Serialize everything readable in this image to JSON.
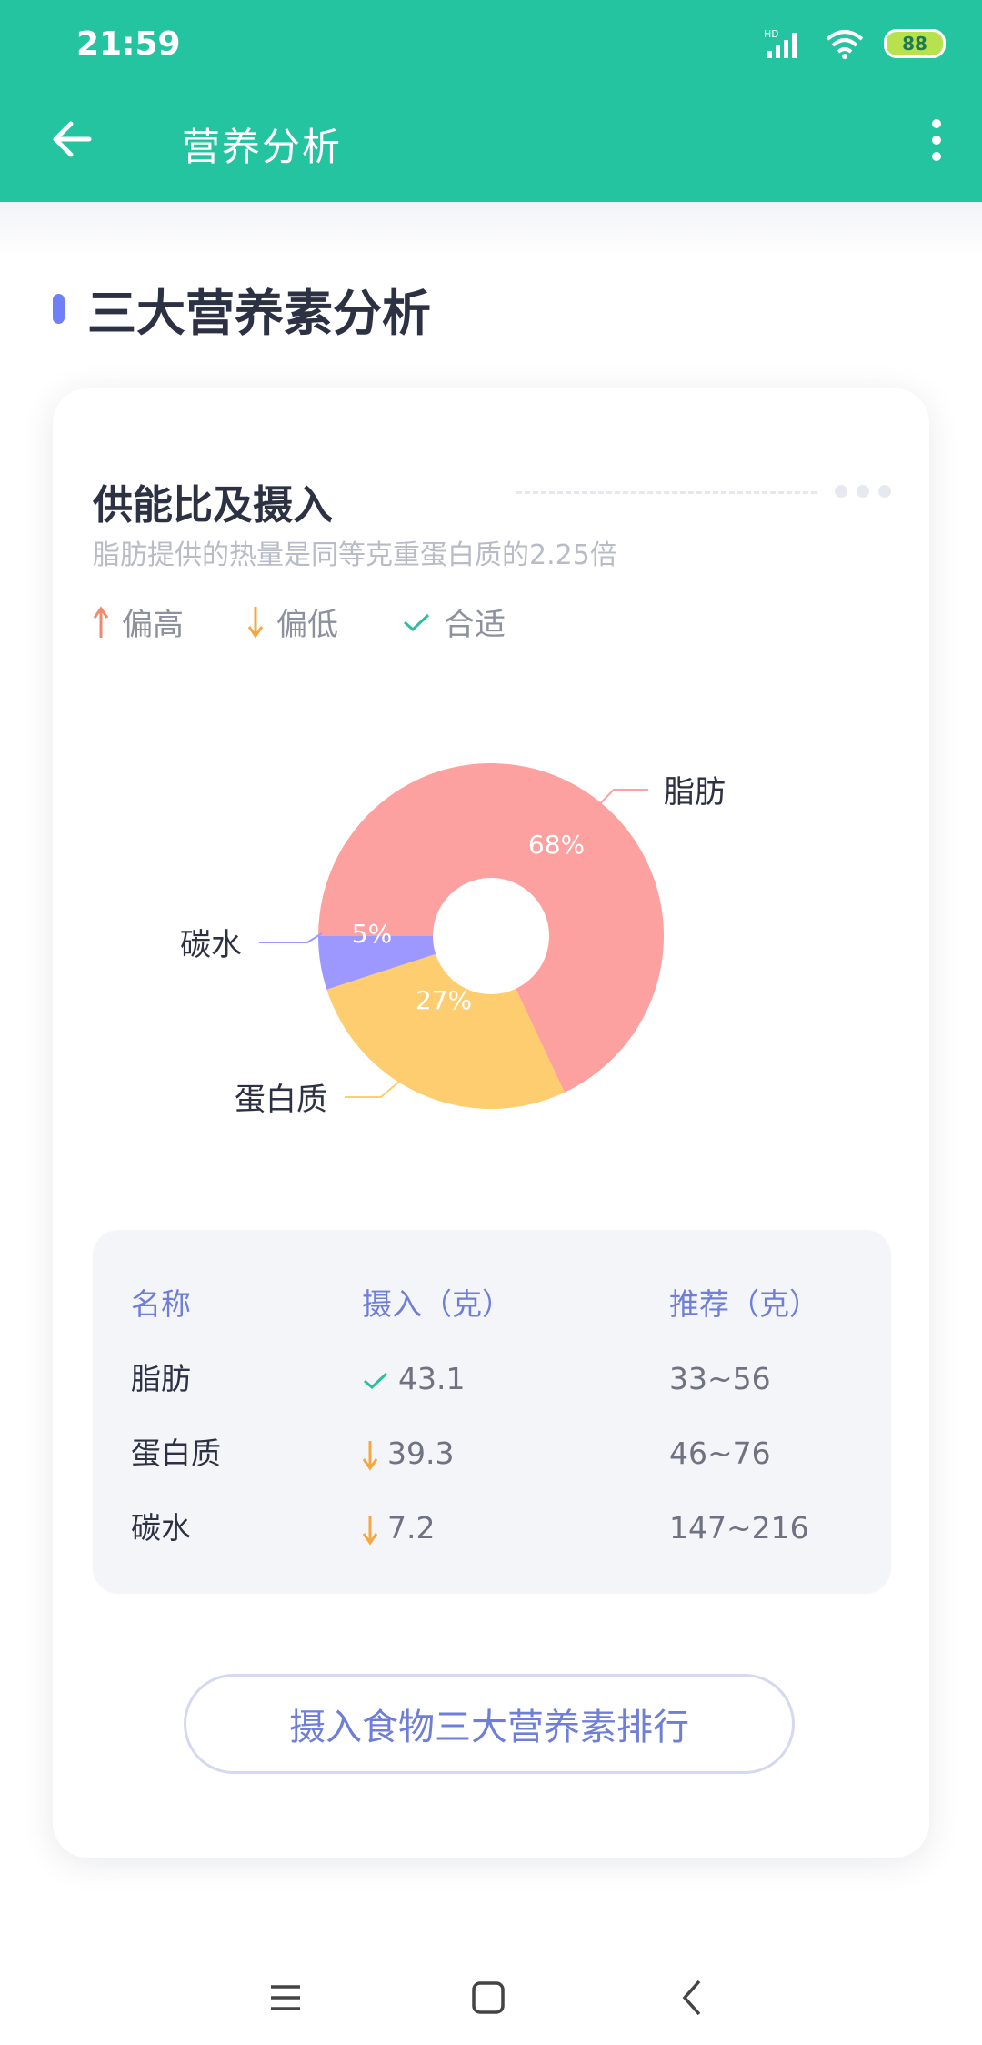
{
  "status_bar": {
    "time": "21:59",
    "network": "HD",
    "battery": "88"
  },
  "app_bar": {
    "title": "营养分析",
    "back_icon": "back-arrow-icon",
    "menu_icon": "more-vertical-icon"
  },
  "section": {
    "title": "三大营养素分析"
  },
  "card": {
    "title": "供能比及摄入",
    "subtitle": "脂肪提供的热量是同等克重蛋白质的2.25倍",
    "legend": [
      {
        "label": "偏高",
        "icon": "arrow-up-icon",
        "color": "#f08a6c"
      },
      {
        "label": "偏低",
        "icon": "arrow-down-icon",
        "color": "#f5a742"
      },
      {
        "label": "合适",
        "icon": "check-icon",
        "color": "#2cbf9f"
      }
    ]
  },
  "chart_data": {
    "type": "pie",
    "categories": [
      "脂肪",
      "蛋白质",
      "碳水"
    ],
    "values": [
      68,
      27,
      5
    ],
    "data_labels": [
      "68%",
      "27%",
      "5%"
    ],
    "colors": [
      "#fca19f",
      "#fdcd70",
      "#9c98ff"
    ],
    "donut": true
  },
  "table": {
    "headers": [
      "名称",
      "摄入（克）",
      "推荐（克）"
    ],
    "rows": [
      {
        "name": "脂肪",
        "status": "check-icon",
        "intake": "43.1",
        "recommended": "33~56"
      },
      {
        "name": "蛋白质",
        "status": "arrow-down-icon",
        "intake": "39.3",
        "recommended": "46~76"
      },
      {
        "name": "碳水",
        "status": "arrow-down-icon",
        "intake": "7.2",
        "recommended": "147~216"
      }
    ]
  },
  "button": {
    "label": "摄入食物三大营养素排行"
  },
  "nav_bar": {
    "icons": [
      "menu-icon",
      "home-square-icon",
      "back-chevron-icon"
    ]
  }
}
